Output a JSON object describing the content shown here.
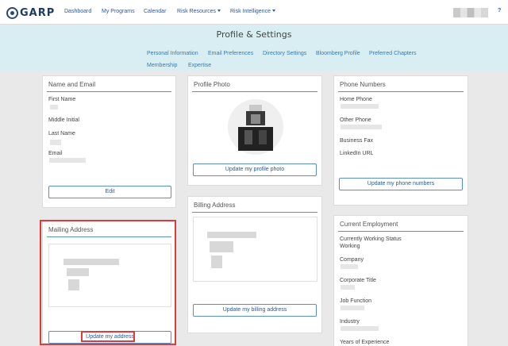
{
  "nav": {
    "logo": "GARP",
    "links": [
      "Dashboard",
      "My Programs",
      "Calendar",
      "Risk Resources",
      "Risk Intelligence"
    ],
    "help": "?"
  },
  "header": {
    "title": "Profile & Settings",
    "links_row1": [
      "Personal Information",
      "Email Preferences",
      "Directory Settings",
      "Bloomberg Profile",
      "Preferred Chapters"
    ],
    "links_row2": [
      "Membership",
      "Expertise"
    ]
  },
  "name_email": {
    "title": "Name and Email",
    "first_name": "First Name",
    "middle_initial": "Middle Initial",
    "last_name": "Last Name",
    "email": "Email",
    "edit_button": "Edit"
  },
  "mailing": {
    "title": "Mailing Address",
    "button": "Update my address"
  },
  "photo": {
    "title": "Profile Photo",
    "button": "Update my profile photo"
  },
  "billing": {
    "title": "Billing Address",
    "button": "Update my billing address"
  },
  "phones": {
    "title": "Phone Numbers",
    "home": "Home Phone",
    "other": "Other Phone",
    "fax": "Business Fax",
    "linkedin": "LinkedIn URL",
    "button": "Update my phone numbers"
  },
  "employment": {
    "title": "Current Employment",
    "status_label": "Currently Working Status",
    "status_value": "Working",
    "company": "Company",
    "corporate_title": "Corporate Title",
    "job_function": "Job Function",
    "industry": "Industry",
    "years": "Years of Experience"
  },
  "colors": {
    "accent": "#5a8fc4",
    "header_bg": "#d8eef2",
    "highlight": "#e03b3b"
  }
}
